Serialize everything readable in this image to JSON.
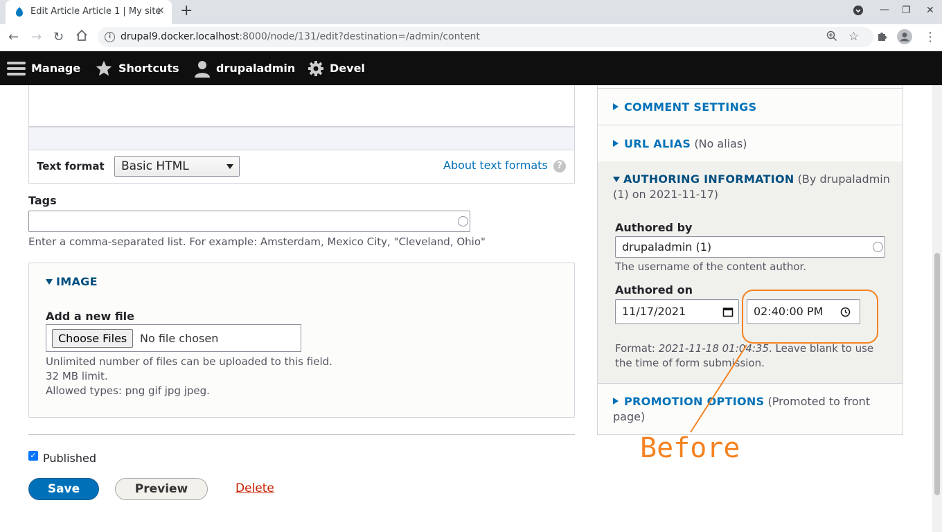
{
  "browser": {
    "tab_title": "Edit Article Article 1 | My site",
    "url_host": "drupal9.docker.localhost",
    "url_rest": ":8000/node/131/edit?destination=/admin/content"
  },
  "toolbar": {
    "manage": "Manage",
    "shortcuts": "Shortcuts",
    "user": "drupaladmin",
    "devel": "Devel"
  },
  "form": {
    "text_format_label": "Text format",
    "text_format_value": "Basic HTML",
    "about_text_formats": "About text formats",
    "tags_label": "Tags",
    "tags_value": "",
    "tags_description": "Enter a comma-separated list. For example: Amsterdam, Mexico City, \"Cleveland, Ohio\"",
    "image_title": "IMAGE",
    "add_file_label": "Add a new file",
    "choose_files": "Choose Files",
    "no_file": "No file chosen",
    "file_desc_1": "Unlimited number of files can be uploaded to this field.",
    "file_desc_2": "32 MB limit.",
    "file_desc_3": "Allowed types: png gif jpg jpeg.",
    "published_label": "Published",
    "save": "Save",
    "preview": "Preview",
    "delete": "Delete"
  },
  "sidebar": {
    "comment_settings": "COMMENT SETTINGS",
    "url_alias": "URL ALIAS",
    "url_alias_summary": "(No alias)",
    "authoring_info": "AUTHORING INFORMATION",
    "authoring_summary_1": "(By drupaladmin",
    "authoring_summary_2": "(1) on 2021-11-17)",
    "authored_by_label": "Authored by",
    "authored_by_value": "drupaladmin (1)",
    "authored_by_desc": "The username of the content author.",
    "authored_on_label": "Authored on",
    "date_value": "11/17/2021",
    "time_value": "02:40:00 PM",
    "format_prefix": "Format: ",
    "format_example": "2021-11-18 01:04:35",
    "format_suffix_1": ". Leave blank to use",
    "format_suffix_2": "the time of form submission.",
    "promotion_options": "PROMOTION OPTIONS",
    "promotion_summary_1": "(Promoted to front",
    "promotion_summary_2": "page)"
  },
  "annotation": {
    "text": "Before",
    "color": "#f58220"
  }
}
